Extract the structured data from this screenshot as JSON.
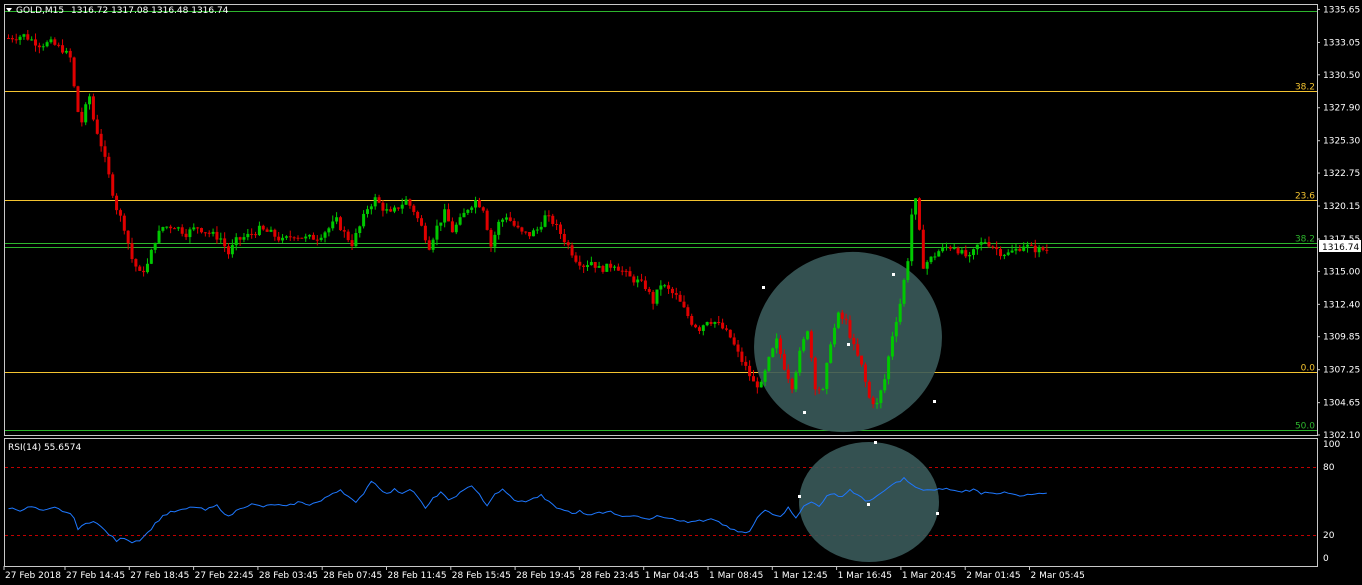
{
  "header": {
    "symbol_label": "GOLD,M15",
    "ohlc": "1316.72 1317.08 1316.48 1316.74"
  },
  "colors": {
    "background": "#000000",
    "bull": "#00c800",
    "bear": "#e00000",
    "rsi_line": "#1e78ff",
    "fib_line": "#f4c430",
    "green_line": "#2db52d",
    "ellipse": "#3a5a5a",
    "rsi_level": "#c00000"
  },
  "chart_data": [
    {
      "type": "candlestick",
      "title": "GOLD,M15",
      "price_axis": {
        "range": [
          1302.1,
          1336.0
        ],
        "tick_labels": [
          "1335.65",
          "1333.05",
          "1330.50",
          "1327.90",
          "1325.30",
          "1322.75",
          "1320.15",
          "1317.55",
          "1315.00",
          "1312.40",
          "1309.85",
          "1307.25",
          "1304.65",
          "1302.10"
        ],
        "current_price": "1316.74"
      },
      "time_axis": {
        "tick_labels": [
          "27 Feb 2018",
          "27 Feb 14:45",
          "27 Feb 18:45",
          "27 Feb 22:45",
          "28 Feb 03:45",
          "28 Feb 07:45",
          "28 Feb 11:45",
          "28 Feb 15:45",
          "28 Feb 19:45",
          "28 Feb 23:45",
          "1 Mar 04:45",
          "1 Mar 08:45",
          "1 Mar 12:45",
          "1 Mar 16:45",
          "1 Mar 20:45",
          "2 Mar 01:45",
          "2 Mar 05:45"
        ]
      },
      "path": [
        [
          0,
          1333.4
        ],
        [
          4,
          1333.6
        ],
        [
          8,
          1332.9
        ],
        [
          11,
          1333.0
        ],
        [
          14,
          1332.5
        ],
        [
          16,
          1331.8
        ],
        [
          17,
          1329.5
        ],
        [
          18,
          1327.6
        ],
        [
          19,
          1326.8
        ],
        [
          20,
          1327.9
        ],
        [
          21,
          1328.8
        ],
        [
          22,
          1327.0
        ],
        [
          24,
          1325.0
        ],
        [
          26,
          1322.5
        ],
        [
          28,
          1320.0
        ],
        [
          30,
          1318.5
        ],
        [
          32,
          1316.0
        ],
        [
          34,
          1314.8
        ],
        [
          36,
          1315.5
        ],
        [
          38,
          1317.5
        ],
        [
          40,
          1318.5
        ],
        [
          43,
          1318.6
        ],
        [
          46,
          1318.0
        ],
        [
          49,
          1318.5
        ],
        [
          52,
          1318.0
        ],
        [
          55,
          1317.6
        ],
        [
          57,
          1316.4
        ],
        [
          59,
          1317.4
        ],
        [
          62,
          1317.8
        ],
        [
          65,
          1318.3
        ],
        [
          68,
          1318.0
        ],
        [
          71,
          1317.4
        ],
        [
          74,
          1317.9
        ],
        [
          77,
          1317.6
        ],
        [
          80,
          1317.7
        ],
        [
          83,
          1318.4
        ],
        [
          85,
          1319.0
        ],
        [
          87,
          1318.0
        ],
        [
          89,
          1317.2
        ],
        [
          91,
          1318.5
        ],
        [
          93,
          1320.0
        ],
        [
          95,
          1320.7
        ],
        [
          97,
          1320.0
        ],
        [
          99,
          1319.5
        ],
        [
          101,
          1320.1
        ],
        [
          103,
          1320.6
        ],
        [
          105,
          1319.8
        ],
        [
          107,
          1318.5
        ],
        [
          109,
          1317.0
        ],
        [
          111,
          1318.5
        ],
        [
          113,
          1319.6
        ],
        [
          115,
          1318.2
        ],
        [
          117,
          1319.0
        ],
        [
          119,
          1320.0
        ],
        [
          121,
          1320.6
        ],
        [
          123,
          1320.0
        ],
        [
          124,
          1318.5
        ],
        [
          125,
          1317.0
        ],
        [
          127,
          1318.8
        ],
        [
          129,
          1319.4
        ],
        [
          131,
          1318.6
        ],
        [
          133,
          1318.0
        ],
        [
          135,
          1317.9
        ],
        [
          137,
          1318.3
        ],
        [
          139,
          1319.3
        ],
        [
          141,
          1318.9
        ],
        [
          143,
          1318.0
        ],
        [
          145,
          1317.0
        ],
        [
          147,
          1316.0
        ],
        [
          149,
          1315.5
        ],
        [
          151,
          1315.8
        ],
        [
          153,
          1315.2
        ],
        [
          155,
          1315.3
        ],
        [
          157,
          1315.6
        ],
        [
          159,
          1315.0
        ],
        [
          161,
          1314.5
        ],
        [
          163,
          1314.2
        ],
        [
          165,
          1313.8
        ],
        [
          167,
          1312.6
        ],
        [
          169,
          1314.0
        ],
        [
          171,
          1313.5
        ],
        [
          173,
          1313.0
        ],
        [
          175,
          1312.0
        ],
        [
          177,
          1311.0
        ],
        [
          179,
          1310.5
        ],
        [
          181,
          1311.2
        ],
        [
          183,
          1311.0
        ],
        [
          185,
          1310.5
        ],
        [
          187,
          1309.8
        ],
        [
          189,
          1308.5
        ],
        [
          191,
          1307.4
        ],
        [
          193,
          1306.2
        ],
        [
          195,
          1306.0
        ],
        [
          197,
          1308.0
        ],
        [
          199,
          1309.5
        ],
        [
          201,
          1307.5
        ],
        [
          203,
          1306.0
        ],
        [
          205,
          1308.5
        ],
        [
          207,
          1310.5
        ],
        [
          209,
          1306.0
        ],
        [
          211,
          1305.5
        ],
        [
          213,
          1309.5
        ],
        [
          215,
          1311.5
        ],
        [
          217,
          1311.0
        ],
        [
          219,
          1309.0
        ],
        [
          221,
          1307.5
        ],
        [
          223,
          1305.0
        ],
        [
          225,
          1304.5
        ],
        [
          227,
          1306.5
        ],
        [
          229,
          1310.0
        ],
        [
          231,
          1312.5
        ],
        [
          233,
          1316.0
        ],
        [
          234,
          1319.5
        ],
        [
          235,
          1320.5
        ],
        [
          236,
          1318.0
        ],
        [
          237,
          1315.5
        ],
        [
          239,
          1316.0
        ],
        [
          241,
          1316.6
        ],
        [
          243,
          1316.9
        ],
        [
          245,
          1317.0
        ],
        [
          247,
          1316.4
        ],
        [
          249,
          1316.0
        ],
        [
          251,
          1317.0
        ],
        [
          253,
          1317.4
        ],
        [
          255,
          1317.0
        ],
        [
          257,
          1316.5
        ],
        [
          259,
          1316.4
        ],
        [
          261,
          1316.7
        ],
        [
          263,
          1317.1
        ],
        [
          265,
          1316.8
        ],
        [
          267,
          1316.7
        ],
        [
          269,
          1316.74
        ]
      ],
      "horizontal_lines": [
        {
          "price": 1335.5,
          "color": "#2db52d",
          "label": ""
        },
        {
          "price": 1329.2,
          "color": "#f4c430",
          "label": "38.2"
        },
        {
          "price": 1320.62,
          "color": "#f4c430",
          "label": "23.6"
        },
        {
          "price": 1317.2,
          "color": "#2db52d",
          "label": "38.2"
        },
        {
          "price": 1316.9,
          "color": "#2db52d",
          "label": ""
        },
        {
          "price": 1307.06,
          "color": "#f4c430",
          "label": "0.0"
        },
        {
          "price": 1302.5,
          "color": "#2db52d",
          "label": "50.0"
        }
      ]
    },
    {
      "type": "line",
      "title": "RSI(14) 55.6574",
      "y_range": [
        0,
        100
      ],
      "tick_labels": [
        "100",
        "80",
        "20",
        "0"
      ],
      "levels": [
        80,
        20
      ],
      "path": [
        [
          0,
          44
        ],
        [
          3,
          42
        ],
        [
          6,
          45
        ],
        [
          9,
          41
        ],
        [
          12,
          44
        ],
        [
          15,
          40
        ],
        [
          17,
          36
        ],
        [
          18,
          25
        ],
        [
          20,
          30
        ],
        [
          22,
          33
        ],
        [
          24,
          27
        ],
        [
          26,
          21
        ],
        [
          28,
          15
        ],
        [
          30,
          18
        ],
        [
          32,
          14
        ],
        [
          34,
          16
        ],
        [
          36,
          22
        ],
        [
          38,
          30
        ],
        [
          40,
          37
        ],
        [
          42,
          40
        ],
        [
          45,
          42
        ],
        [
          48,
          45
        ],
        [
          51,
          42
        ],
        [
          54,
          46
        ],
        [
          57,
          36
        ],
        [
          60,
          44
        ],
        [
          63,
          47
        ],
        [
          66,
          45
        ],
        [
          69,
          47
        ],
        [
          72,
          45
        ],
        [
          75,
          49
        ],
        [
          78,
          47
        ],
        [
          81,
          50
        ],
        [
          84,
          57
        ],
        [
          86,
          60
        ],
        [
          88,
          54
        ],
        [
          90,
          48
        ],
        [
          92,
          57
        ],
        [
          94,
          68
        ],
        [
          96,
          62
        ],
        [
          98,
          56
        ],
        [
          100,
          60
        ],
        [
          102,
          57
        ],
        [
          104,
          61
        ],
        [
          106,
          54
        ],
        [
          108,
          43
        ],
        [
          110,
          52
        ],
        [
          112,
          58
        ],
        [
          114,
          50
        ],
        [
          116,
          55
        ],
        [
          118,
          59
        ],
        [
          120,
          64
        ],
        [
          122,
          56
        ],
        [
          124,
          45
        ],
        [
          126,
          56
        ],
        [
          128,
          60
        ],
        [
          130,
          54
        ],
        [
          132,
          49
        ],
        [
          134,
          50
        ],
        [
          136,
          52
        ],
        [
          138,
          55
        ],
        [
          140,
          49
        ],
        [
          142,
          44
        ],
        [
          144,
          42
        ],
        [
          146,
          39
        ],
        [
          148,
          41
        ],
        [
          150,
          38
        ],
        [
          152,
          40
        ],
        [
          154,
          39
        ],
        [
          156,
          41
        ],
        [
          158,
          38
        ],
        [
          160,
          36
        ],
        [
          162,
          38
        ],
        [
          164,
          36
        ],
        [
          166,
          33
        ],
        [
          168,
          38
        ],
        [
          170,
          36
        ],
        [
          172,
          35
        ],
        [
          174,
          33
        ],
        [
          176,
          31
        ],
        [
          178,
          33
        ],
        [
          180,
          32
        ],
        [
          182,
          34
        ],
        [
          184,
          31
        ],
        [
          186,
          28
        ],
        [
          188,
          24
        ],
        [
          190,
          22
        ],
        [
          192,
          23
        ],
        [
          194,
          35
        ],
        [
          196,
          42
        ],
        [
          198,
          39
        ],
        [
          200,
          37
        ],
        [
          202,
          44
        ],
        [
          204,
          36
        ],
        [
          206,
          45
        ],
        [
          208,
          49
        ],
        [
          210,
          46
        ],
        [
          212,
          54
        ],
        [
          214,
          56
        ],
        [
          216,
          54
        ],
        [
          218,
          60
        ],
        [
          220,
          55
        ],
        [
          222,
          50
        ],
        [
          224,
          52
        ],
        [
          226,
          56
        ],
        [
          228,
          62
        ],
        [
          230,
          66
        ],
        [
          232,
          70
        ],
        [
          234,
          64
        ],
        [
          236,
          60
        ],
        [
          238,
          60
        ],
        [
          240,
          59
        ],
        [
          242,
          61
        ],
        [
          244,
          60
        ],
        [
          246,
          58
        ],
        [
          248,
          59
        ],
        [
          250,
          60
        ],
        [
          252,
          57
        ],
        [
          254,
          58
        ],
        [
          256,
          57
        ],
        [
          258,
          57
        ],
        [
          260,
          56
        ],
        [
          262,
          54
        ],
        [
          264,
          55
        ],
        [
          266,
          56
        ],
        [
          269,
          56
        ]
      ]
    }
  ]
}
